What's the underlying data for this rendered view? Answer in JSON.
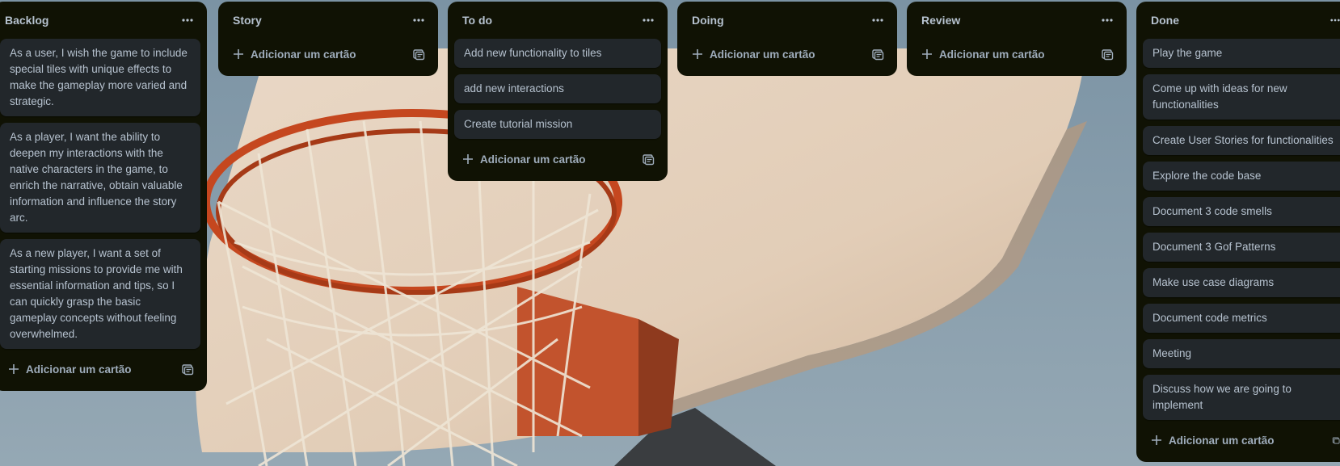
{
  "theme": {
    "list_bg": "#101204",
    "card_bg": "#22272b",
    "text": "#b6c2cf",
    "muted": "#9fadbc"
  },
  "add_card_label": "Adicionar um cartão",
  "lists": [
    {
      "title": "Backlog",
      "cards": [
        "As a user, I wish the game to include special tiles with unique effects to make the gameplay more varied and strategic.",
        "As a player, I want the ability to deepen my interactions with the native characters in the game, to enrich the narrative, obtain valuable information and influence the story arc.",
        "As a new player, I want a set of starting missions to provide me with essential information and tips, so I can quickly grasp the basic gameplay concepts without feeling overwhelmed."
      ]
    },
    {
      "title": "Story",
      "cards": []
    },
    {
      "title": "To do",
      "cards": [
        "Add new functionality to tiles",
        "add new interactions",
        "Create tutorial mission"
      ]
    },
    {
      "title": "Doing",
      "cards": []
    },
    {
      "title": "Review",
      "cards": []
    },
    {
      "title": "Done",
      "cards": [
        "Play the game",
        "Come up with ideas for new functionalities",
        "Create User Stories for functionalities",
        "Explore the code base",
        "Document 3 code smells",
        "Document 3 Gof Patterns",
        "Make use case diagrams",
        "Document code metrics",
        "Meeting",
        "Discuss how we are going to implement"
      ]
    }
  ]
}
